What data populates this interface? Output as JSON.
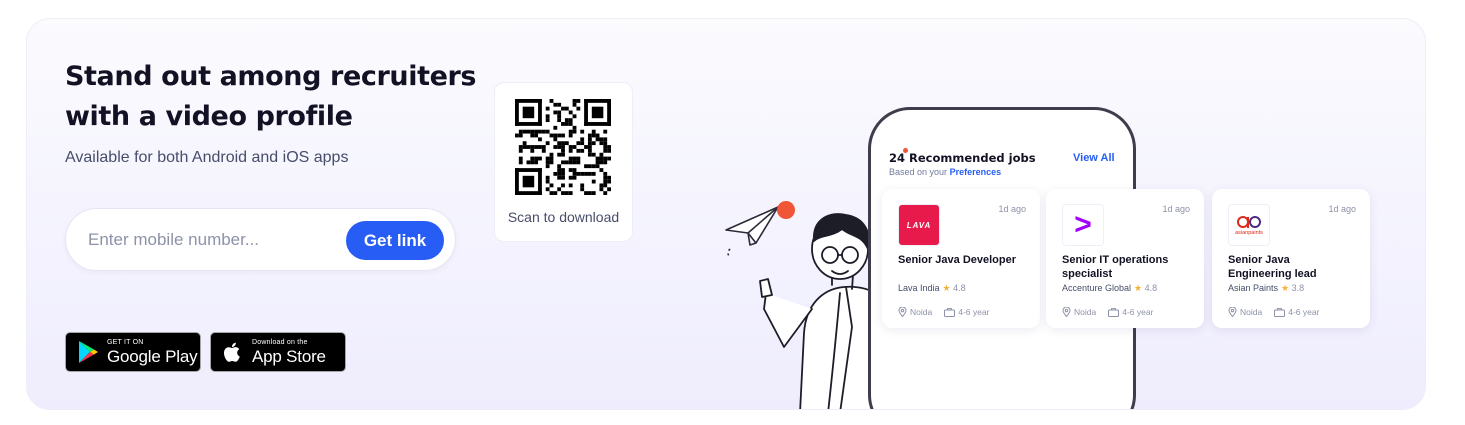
{
  "hero": {
    "headline_line1": "Stand out among recruiters",
    "headline_line2": "with a video profile",
    "subtitle": "Available for both Android and iOS apps"
  },
  "mobile_form": {
    "placeholder": "Enter mobile number...",
    "value": "",
    "button_label": "Get link"
  },
  "stores": {
    "google_play": {
      "small": "GET IT ON",
      "big": "Google Play"
    },
    "app_store": {
      "small": "Download on the",
      "big": "App Store"
    }
  },
  "qr": {
    "caption": "Scan to download"
  },
  "recommended": {
    "count": "24",
    "title": "Recommended jobs",
    "subtitle_prefix": "Based on your",
    "subtitle_link": "Preferences",
    "view_all": "View All",
    "jobs": [
      {
        "logo_text": "LAVA",
        "age": "1d ago",
        "title": "Senior Java Developer",
        "company": "Lava India",
        "rating": "4.8",
        "location": "Noida",
        "experience": "4-6 year",
        "logo_color": "#e8194b"
      },
      {
        "logo_text": ">",
        "age": "1d ago",
        "title": "Senior IT operations specialist",
        "company": "Accenture Global",
        "rating": "4.8",
        "location": "Noida",
        "experience": "4-6 year",
        "logo_color": "#a100ff"
      },
      {
        "logo_text": "asianpaints",
        "age": "1d ago",
        "title": "Senior Java Engineering lead",
        "company": "Asian Paints",
        "rating": "3.8",
        "location": "Noida",
        "experience": "4-6 year",
        "logo_color": "#e1261c"
      }
    ]
  },
  "colors": {
    "accent": "#275df5",
    "heading": "#121224",
    "star": "#f8b133"
  }
}
